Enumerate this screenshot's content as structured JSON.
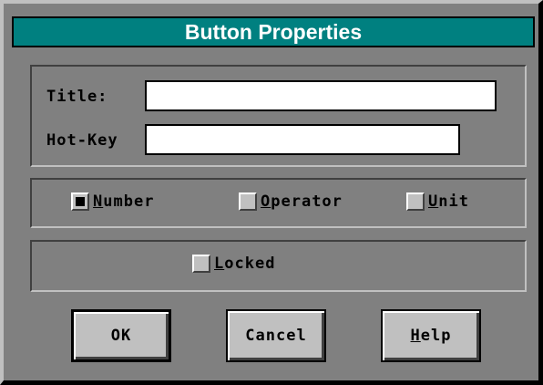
{
  "dialog": {
    "title": "Button Properties"
  },
  "fields": {
    "title_label": "Title:",
    "title_value": "",
    "hotkey_label": "Hot-Key",
    "hotkey_value": ""
  },
  "type_options": [
    {
      "hotkey": "N",
      "rest": "umber",
      "checked": true
    },
    {
      "hotkey": "O",
      "rest": "perator",
      "checked": false
    },
    {
      "hotkey": "U",
      "rest": "nit",
      "checked": false
    }
  ],
  "locked": {
    "hotkey": "L",
    "rest": "ocked",
    "checked": false
  },
  "buttons": {
    "ok": "OK",
    "cancel": "Cancel",
    "help_hotkey": "H",
    "help_rest": "elp"
  }
}
